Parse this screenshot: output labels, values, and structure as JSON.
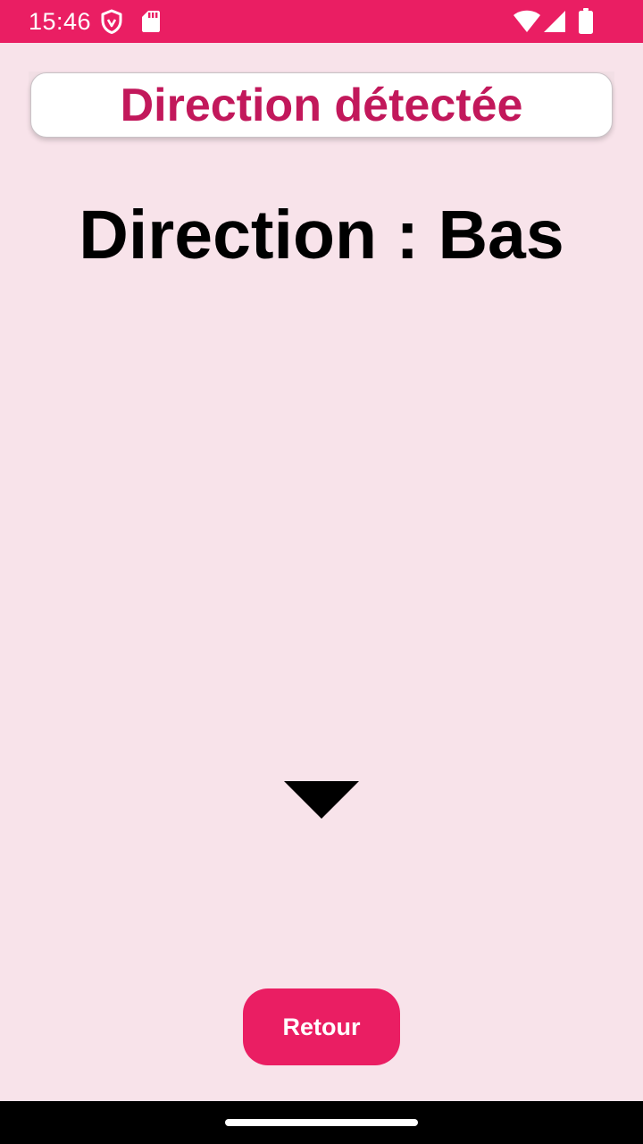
{
  "status_bar": {
    "time": "15:46",
    "icons_left": [
      "shield-icon",
      "sd-card-icon"
    ],
    "icons_right": [
      "wifi-icon",
      "signal-icon",
      "battery-icon"
    ],
    "background_color": "#ea1e63"
  },
  "header": {
    "title": "Direction détectée",
    "title_color": "#c2185b"
  },
  "main": {
    "direction_label": "Direction : Bas",
    "arrow_icon": "arrow-down-triangle-icon"
  },
  "footer": {
    "back_label": "Retour",
    "button_color": "#ea1e63"
  },
  "colors": {
    "background": "#f8e3ea"
  }
}
